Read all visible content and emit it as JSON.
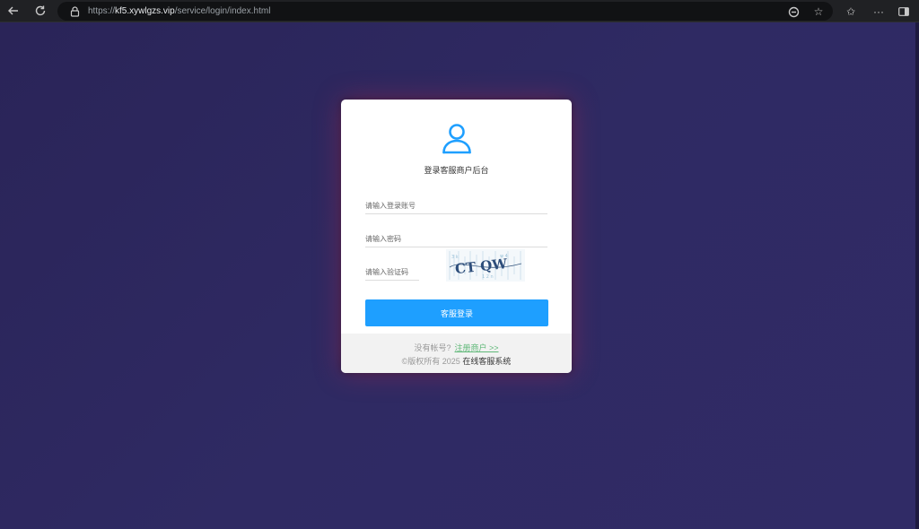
{
  "browser": {
    "url_scheme": "https://",
    "url_host": "kf5.xywlgzs.vip",
    "url_path": "/service/login/index.html",
    "icons": {
      "back": "arrow-left-icon",
      "reload": "reload-icon",
      "lock": "lock-icon",
      "translate": "browser-essentials-icon",
      "favorite": "star-icon",
      "favorites_bar": "favorites-icon",
      "more": "more-icon",
      "sidebar": "sidebar-icon"
    }
  },
  "login": {
    "title": "登录客服商户后台",
    "account_placeholder": "请输入登录账号",
    "password_placeholder": "请输入密码",
    "captcha_placeholder": "请输入验证码",
    "captcha_text": "CT QW",
    "submit_label": "客服登录",
    "no_account_text": "没有帐号?",
    "register_link": "注册商户 >>",
    "copyright_prefix": "©版权所有 2025",
    "copyright_brand": "在线客服系统"
  },
  "colors": {
    "background": "#2b2658",
    "button": "#1e9fff",
    "link": "#5fb878",
    "avatar": "#1e9fff"
  }
}
